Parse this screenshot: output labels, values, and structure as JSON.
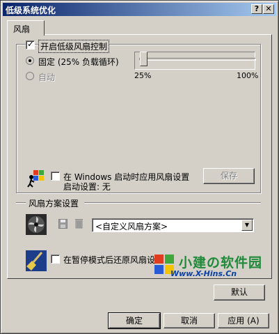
{
  "window": {
    "title": "低级系统优化",
    "help_btn": "?",
    "close_btn": "✕"
  },
  "tabs": [
    {
      "label": "风扇"
    }
  ],
  "fan_control": {
    "enable_label": "开启低级风扇控制",
    "enabled": true,
    "fixed_label": "固定 (25% 负载循环)",
    "auto_label": "自动",
    "slider": {
      "value": 25,
      "min_label": "25%",
      "max_label": "100%"
    }
  },
  "startup": {
    "apply_label": "在 Windows 启动时应用风扇设置",
    "status_label": "启动设置: 无",
    "save_button": "保存"
  },
  "scheme": {
    "group_label": "风扇方案设置",
    "selected": "<自定义风扇方案>"
  },
  "restore": {
    "label": "在暂停模式后还原风扇设置"
  },
  "buttons": {
    "default": "默认",
    "ok": "确定",
    "cancel": "取消",
    "apply": "应用 (A)"
  },
  "watermark": {
    "name": "小建の软件园",
    "url": "Www.X-Hins.Cn"
  }
}
